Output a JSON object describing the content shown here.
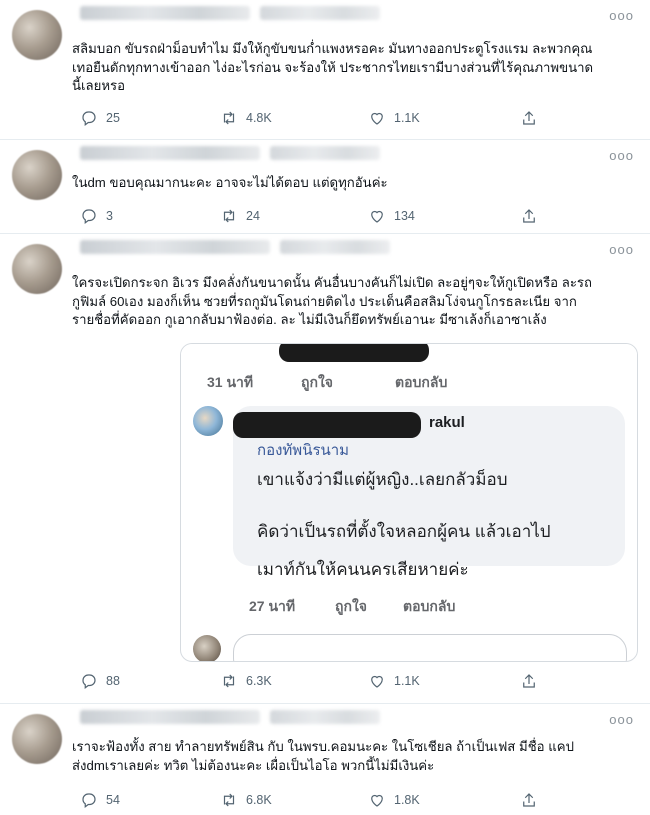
{
  "tweets": [
    {
      "id": "t1",
      "more": "ooo",
      "lines": [
        "สลิมบอก ขับรถฝ่าม็อบทำไม มึงให้กูขับขนก่ำแพงหรอคะ มันทางออกประตูโรงแรม ละพวกคุณ",
        "เทอยืนดักทุกทางเข้าออก ไง่อะไรก่อน จะร้องให้ ประชากรไทยเรามีบางส่วนที่ไร้คุณภาพขนาด",
        "นี้เลยหรอ"
      ],
      "stats": {
        "replies": "25",
        "retweets": "4.8K",
        "likes": "1.1K"
      }
    },
    {
      "id": "t2",
      "more": "ooo",
      "lines": [
        "ในdm ขอบคุณมากนะคะ อาจจะไม่ได้ตอบ แต่ดูทุกอันค่ะ"
      ],
      "stats": {
        "replies": "3",
        "retweets": "24",
        "likes": "134"
      }
    },
    {
      "id": "t3",
      "more": "ooo",
      "lines": [
        "ใครจะเปิดกระจก อิเวร มึงคลั่งกันขนาดนั้น คันอื่นบางคันก็ไม่เปิด ละอยู่ๆจะให้กูเปิดหรือ ละรถ",
        "กูฟิมล์ 60เอง  มองก็เห็น ซวยที่รถกูมันโดนถ่ายติดไง ประเด็นคือสลิมโง่จนกูโกรธละเนีย จาก",
        "รายชื่อที่คัดออก กูเอากลับมาฟ้องต่อ. ละ ไม่มีเงินก็ยึดทรัพย์เอานะ มีซาเล้งก็เอาซาเล้ง"
      ],
      "stats": {
        "replies": "88",
        "retweets": "6.3K",
        "likes": "1.1K"
      },
      "embed": {
        "top_time": "31 นาที",
        "top_like": "ถูกใจ",
        "top_reply": "ตอบกลับ",
        "handle_suffix": "rakul",
        "sub_label": "กองทัพนิรนาม",
        "line1": "เขาแจ้งว่ามีแต่ผู้หญิง..เลยกลัวม็อบ",
        "line2": "คิดว่าเป็นรถที่ตั้งใจหลอกผู้คน แล้วเอาไป",
        "line3": "เมาท์กันให้คนนครเสียหายค่ะ",
        "bottom_time": "27 นาที",
        "bottom_like": "ถูกใจ",
        "bottom_reply": "ตอบกลับ"
      }
    },
    {
      "id": "t4",
      "more": "ooo",
      "lines": [
        "เราจะฟ้องทั้ง สาย ทำลายทรัพย์สิน กับ ในพรบ.คอมนะคะ ในโซเชียล ถ้าเป็นเฟส มีชื่อ แคป",
        "ส่งdmเราเลยค่ะ ทวิต ไม่ต้องนะคะ เผื่อเป็นไอโอ พวกนี้ไม่มีเงินค่ะ"
      ],
      "stats": {
        "replies": "54",
        "retweets": "6.8K",
        "likes": "1.8K"
      }
    }
  ],
  "icons": {
    "reply": "reply-icon",
    "retweet": "retweet-icon",
    "like": "like-icon",
    "share": "share-icon",
    "more": "more-icon"
  },
  "colors": {
    "text": "#0f1419",
    "secondary": "#536471",
    "divider": "#e6ecf0",
    "fb_link": "#385898"
  }
}
